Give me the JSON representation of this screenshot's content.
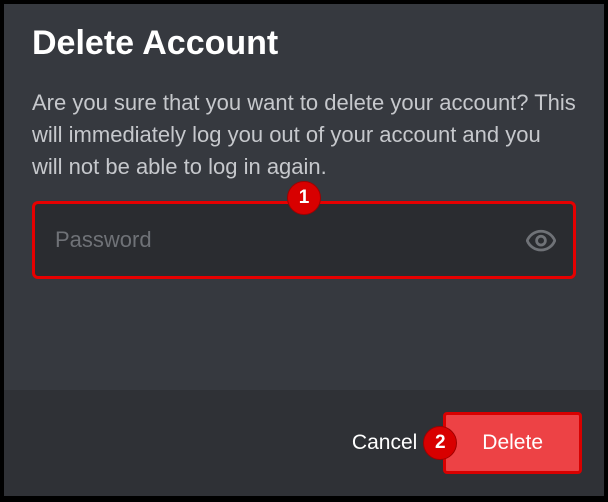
{
  "dialog": {
    "title": "Delete Account",
    "description": "Are you sure that you want to delete your account? This will immediately log you out of your account and you will not be able to log in again."
  },
  "input": {
    "placeholder": "Password"
  },
  "buttons": {
    "cancel": "Cancel",
    "delete": "Delete"
  },
  "annotations": {
    "badge1": "1",
    "badge2": "2"
  }
}
